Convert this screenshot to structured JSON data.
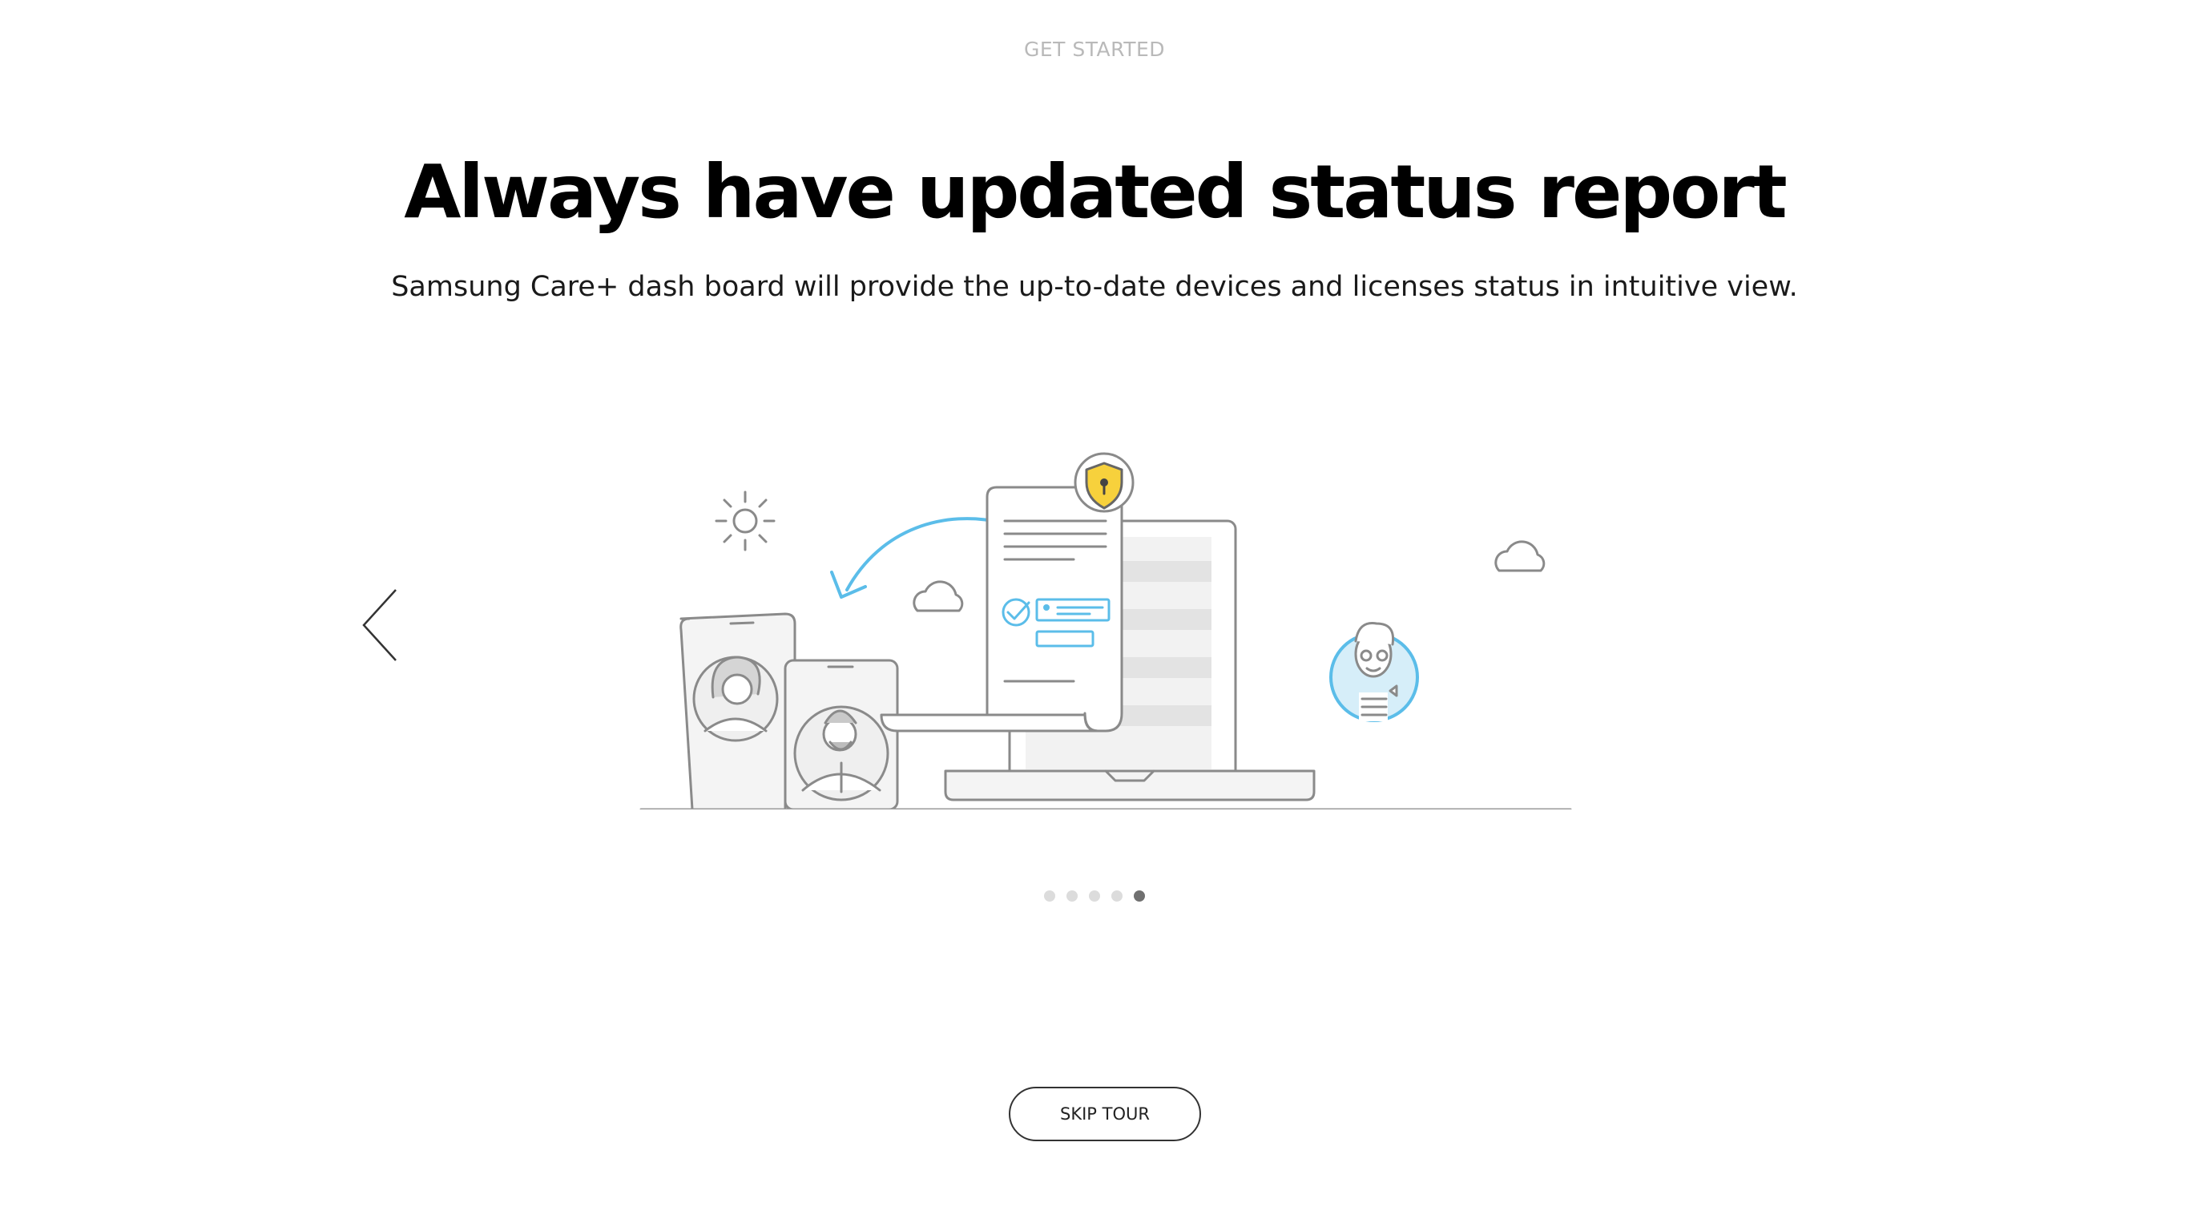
{
  "header": {
    "eyebrow": "GET STARTED",
    "title": "Always have updated status report",
    "subtitle": "Samsung Care+ dash board will provide the up-to-date devices and licenses status in intuitive view."
  },
  "carousel": {
    "total_slides": 5,
    "active_index": 4,
    "prev_icon": "chevron-left-icon"
  },
  "footer": {
    "skip_label": "SKIP TOUR"
  },
  "colors": {
    "accent_blue": "#5bbde9",
    "shield_yellow": "#f7d13c",
    "line_gray": "#8a8a8a",
    "fill_gray": "#efefef",
    "dot_inactive": "#dcdcdc",
    "dot_active": "#707070"
  }
}
